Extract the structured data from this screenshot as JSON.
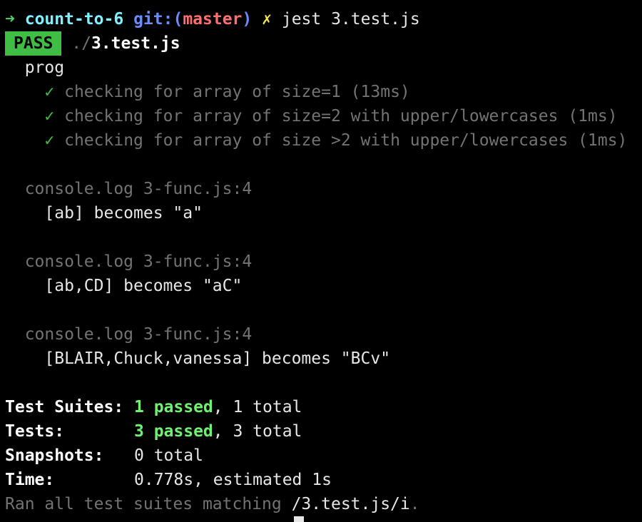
{
  "prompt": {
    "arrow": "➜",
    "directory": "count-to-6",
    "git_prefix": "git:(",
    "branch": "master",
    "git_suffix": ")",
    "dirty": "✗",
    "command": "jest 3.test.js"
  },
  "result": {
    "badge": "PASS",
    "path_dir": "./",
    "path_file": "3.test.js"
  },
  "suite": {
    "name": "prog",
    "check_mark": "✓",
    "tests": [
      "checking for array of size=1 (13ms)",
      "checking for array of size=2 with upper/lowercases (1ms)",
      "checking for array of size >2 with upper/lowercases (1ms)"
    ]
  },
  "console_logs": [
    {
      "source": "console.log 3-func.js:4",
      "message": "[ab] becomes \"a\""
    },
    {
      "source": "console.log 3-func.js:4",
      "message": "[ab,CD] becomes \"aC\""
    },
    {
      "source": "console.log 3-func.js:4",
      "message": "[BLAIR,Chuck,vanessa] becomes \"BCv\""
    }
  ],
  "summary": {
    "suites_label": "Test Suites:",
    "suites_passed": "1 passed",
    "suites_total": ", 1 total",
    "tests_label": "Tests:",
    "tests_passed": "3 passed",
    "tests_total": ", 3 total",
    "snapshots_label": "Snapshots:",
    "snapshots_value": "0 total",
    "time_label": "Time:",
    "time_value": "0.778s, estimated 1s",
    "ran_prefix": "Ran all test suites matching ",
    "ran_pattern": "/3.test.js/i",
    "ran_suffix": "."
  },
  "colors": {
    "background": "#000000",
    "pass_badge": "#3fbd44",
    "directory": "#7ff0ff",
    "branch": "#ff6e6e",
    "git": "#6a8cff",
    "dirty": "#f4e857",
    "passed": "#6ff26f"
  }
}
